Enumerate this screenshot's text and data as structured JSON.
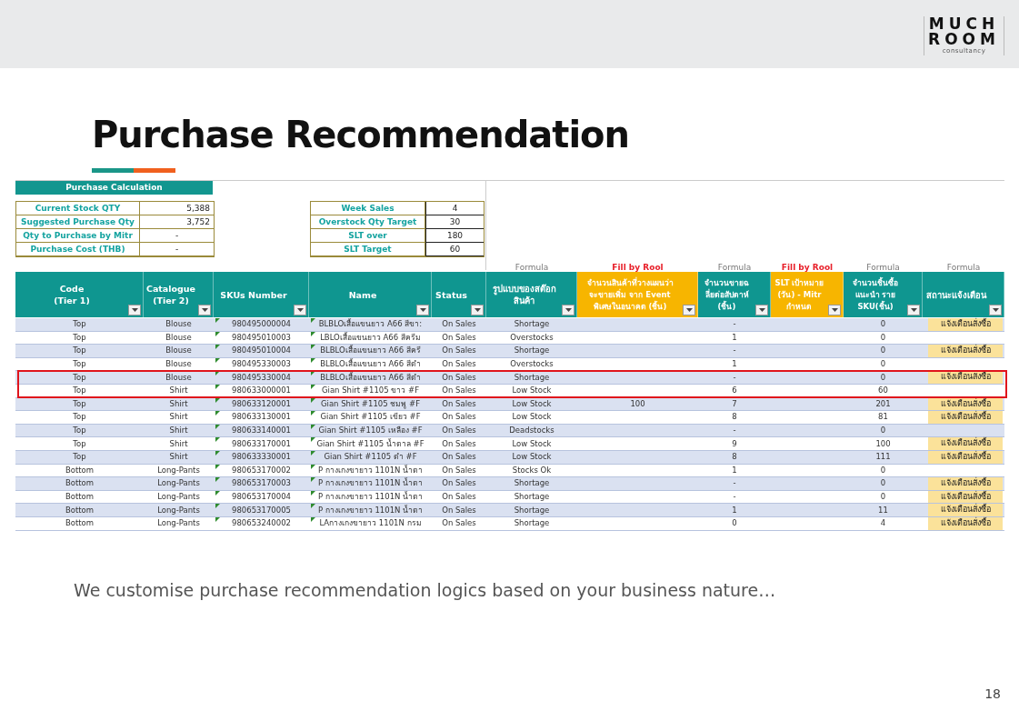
{
  "logo": {
    "line1": "MUCH",
    "line2": "ROOM",
    "tagline": "consultancy"
  },
  "title": "Purchase Recommendation",
  "sheet": {
    "calc_table": {
      "title": "Purchase Calculation",
      "rows": [
        {
          "label": "Current Stock QTY",
          "value": "5,388"
        },
        {
          "label": "Suggested Purchase Qty",
          "value": "3,752"
        },
        {
          "label": "Qty to Purchase by Mitr",
          "value": "-"
        },
        {
          "label": "Purchase Cost (THB)",
          "value": "-"
        }
      ]
    },
    "params_table": {
      "rows": [
        {
          "label": "Week Sales",
          "value": "4"
        },
        {
          "label": "Overstock Qty Target",
          "value": "30"
        },
        {
          "label": "SLT over",
          "value": "180"
        },
        {
          "label": "SLT Target",
          "value": "60"
        }
      ]
    },
    "columns": [
      {
        "lines": [
          "Code",
          "(Tier 1)"
        ],
        "kind": "computed"
      },
      {
        "lines": [
          "Catalogue",
          "(Tier 2)"
        ],
        "kind": "computed"
      },
      {
        "lines": [
          "SKUs Number"
        ],
        "kind": "computed"
      },
      {
        "lines": [
          "Name"
        ],
        "kind": "computed"
      },
      {
        "lines": [
          "Status"
        ],
        "kind": "computed"
      },
      {
        "lines": [
          "รูปแบบของสต๊อก",
          "สินค้า"
        ],
        "kind": "computed",
        "note": "Formula"
      },
      {
        "lines": [
          "จำนวนสินค้าที่วางแผนว่า",
          "จะขายเพิ่ม จาก Event",
          "พิเศษในอนาคต (ชิ้น)"
        ],
        "kind": "input",
        "note": "Fill by Rool"
      },
      {
        "lines": [
          "จำนวนขายฉ",
          "ลี่ยต่อสัปดาห์",
          "(ชิ้น)"
        ],
        "kind": "computed",
        "note": "Formula"
      },
      {
        "lines": [
          "SLT เป้าหมาย",
          "(วัน) - Mitr",
          "กำหนด"
        ],
        "kind": "input",
        "note": "Fill by Rool"
      },
      {
        "lines": [
          "จำนวนชิ้นซื้อ",
          "แนะนำ ราย",
          "SKU(ชิ้น)"
        ],
        "kind": "computed",
        "note": "Formula"
      },
      {
        "lines": [
          "สถานะแจ้งเตือน"
        ],
        "kind": "computed",
        "note": "Formula"
      }
    ],
    "rows": [
      {
        "code": "Top",
        "catalogue": "Blouse",
        "sku": "980495000004",
        "name": "BLBLOเสื้อแขนยาว A66 สีขา:",
        "status": "On Sales",
        "stock_type": "Shortage",
        "weekly_sales": "-",
        "suggested_qty": "0",
        "alert": "แจ้งเตือนสั่งซื้อ",
        "highlighted": false
      },
      {
        "code": "Top",
        "catalogue": "Blouse",
        "sku": "980495010003",
        "name": "LBLOเสื้อแขนยาว A66 สีครีม",
        "status": "On Sales",
        "stock_type": "Overstocks",
        "weekly_sales": "1",
        "suggested_qty": "0",
        "highlighted": false
      },
      {
        "code": "Top",
        "catalogue": "Blouse",
        "sku": "980495010004",
        "name": "BLBLOเสื้อแขนยาว A66 สีครี",
        "status": "On Sales",
        "stock_type": "Shortage",
        "weekly_sales": "-",
        "suggested_qty": "0",
        "alert": "แจ้งเตือนสั่งซื้อ",
        "highlighted": false
      },
      {
        "code": "Top",
        "catalogue": "Blouse",
        "sku": "980495330003",
        "name": "BLBLOเสื้อแขนยาว A66 สีดำ",
        "status": "On Sales",
        "stock_type": "Overstocks",
        "weekly_sales": "1",
        "suggested_qty": "0",
        "highlighted": false
      },
      {
        "code": "Top",
        "catalogue": "Blouse",
        "sku": "980495330004",
        "name": "BLBLOเสื้อแขนยาว A66 สีดำ",
        "status": "On Sales",
        "stock_type": "Shortage",
        "weekly_sales": "-",
        "suggested_qty": "0",
        "alert": "แจ้งเตือนสั่งซื้อ",
        "highlighted": true
      },
      {
        "code": "Top",
        "catalogue": "Shirt",
        "sku": "980633000001",
        "name": "Gian Shirt #1105 ขาว #F",
        "status": "On Sales",
        "stock_type": "Low Stock",
        "weekly_sales": "6",
        "suggested_qty": "60",
        "highlighted": true
      },
      {
        "code": "Top",
        "catalogue": "Shirt",
        "sku": "980633120001",
        "name": "Gian Shirt #1105 ชมพู #F",
        "status": "On Sales",
        "stock_type": "Low Stock",
        "event_qty": "100",
        "weekly_sales": "7",
        "suggested_qty": "201",
        "alert": "แจ้งเตือนสั่งซื้อ",
        "highlighted": false
      },
      {
        "code": "Top",
        "catalogue": "Shirt",
        "sku": "980633130001",
        "name": "Gian Shirt #1105 เขียว #F",
        "status": "On Sales",
        "stock_type": "Low Stock",
        "weekly_sales": "8",
        "suggested_qty": "81",
        "alert": "แจ้งเตือนสั่งซื้อ",
        "highlighted": false
      },
      {
        "code": "Top",
        "catalogue": "Shirt",
        "sku": "980633140001",
        "name": "Gian Shirt #1105 เหลือง #F",
        "status": "On Sales",
        "stock_type": "Deadstocks",
        "weekly_sales": "-",
        "suggested_qty": "0",
        "highlighted": false
      },
      {
        "code": "Top",
        "catalogue": "Shirt",
        "sku": "980633170001",
        "name": "Gian Shirt #1105 น้ำตาล #F",
        "status": "On Sales",
        "stock_type": "Low Stock",
        "weekly_sales": "9",
        "suggested_qty": "100",
        "alert": "แจ้งเตือนสั่งซื้อ",
        "highlighted": false
      },
      {
        "code": "Top",
        "catalogue": "Shirt",
        "sku": "980633330001",
        "name": "Gian Shirt #1105 ดำ #F",
        "status": "On Sales",
        "stock_type": "Low Stock",
        "weekly_sales": "8",
        "suggested_qty": "111",
        "alert": "แจ้งเตือนสั่งซื้อ",
        "highlighted": false
      },
      {
        "code": "Bottom",
        "catalogue": "Long-Pants",
        "sku": "980653170002",
        "name": "P กางเกงขายาว 1101N น้ำตา",
        "status": "On Sales",
        "stock_type": "Stocks Ok",
        "weekly_sales": "1",
        "suggested_qty": "0",
        "highlighted": false
      },
      {
        "code": "Bottom",
        "catalogue": "Long-Pants",
        "sku": "980653170003",
        "name": "P กางเกงขายาว 1101N น้ำตา",
        "status": "On Sales",
        "stock_type": "Shortage",
        "weekly_sales": "-",
        "suggested_qty": "0",
        "alert": "แจ้งเตือนสั่งซื้อ",
        "highlighted": false
      },
      {
        "code": "Bottom",
        "catalogue": "Long-Pants",
        "sku": "980653170004",
        "name": "P กางเกงขายาว 1101N น้ำตา",
        "status": "On Sales",
        "stock_type": "Shortage",
        "weekly_sales": "-",
        "suggested_qty": "0",
        "alert": "แจ้งเตือนสั่งซื้อ",
        "highlighted": false
      },
      {
        "code": "Bottom",
        "catalogue": "Long-Pants",
        "sku": "980653170005",
        "name": "P กางเกงขายาว 1101N น้ำตา",
        "status": "On Sales",
        "stock_type": "Shortage",
        "weekly_sales": "1",
        "suggested_qty": "11",
        "alert": "แจ้งเตือนสั่งซื้อ",
        "highlighted": false
      },
      {
        "code": "Bottom",
        "catalogue": "Long-Pants",
        "sku": "980653240002",
        "name": "LAกางเกงขายาว 1101N กรม",
        "status": "On Sales",
        "stock_type": "Shortage",
        "weekly_sales": "0",
        "suggested_qty": "4",
        "alert": "แจ้งเตือนสั่งซื้อ",
        "highlighted": false
      }
    ]
  },
  "caption": "We customise purchase recommendation logics based on your business nature…",
  "page_number": "18"
}
